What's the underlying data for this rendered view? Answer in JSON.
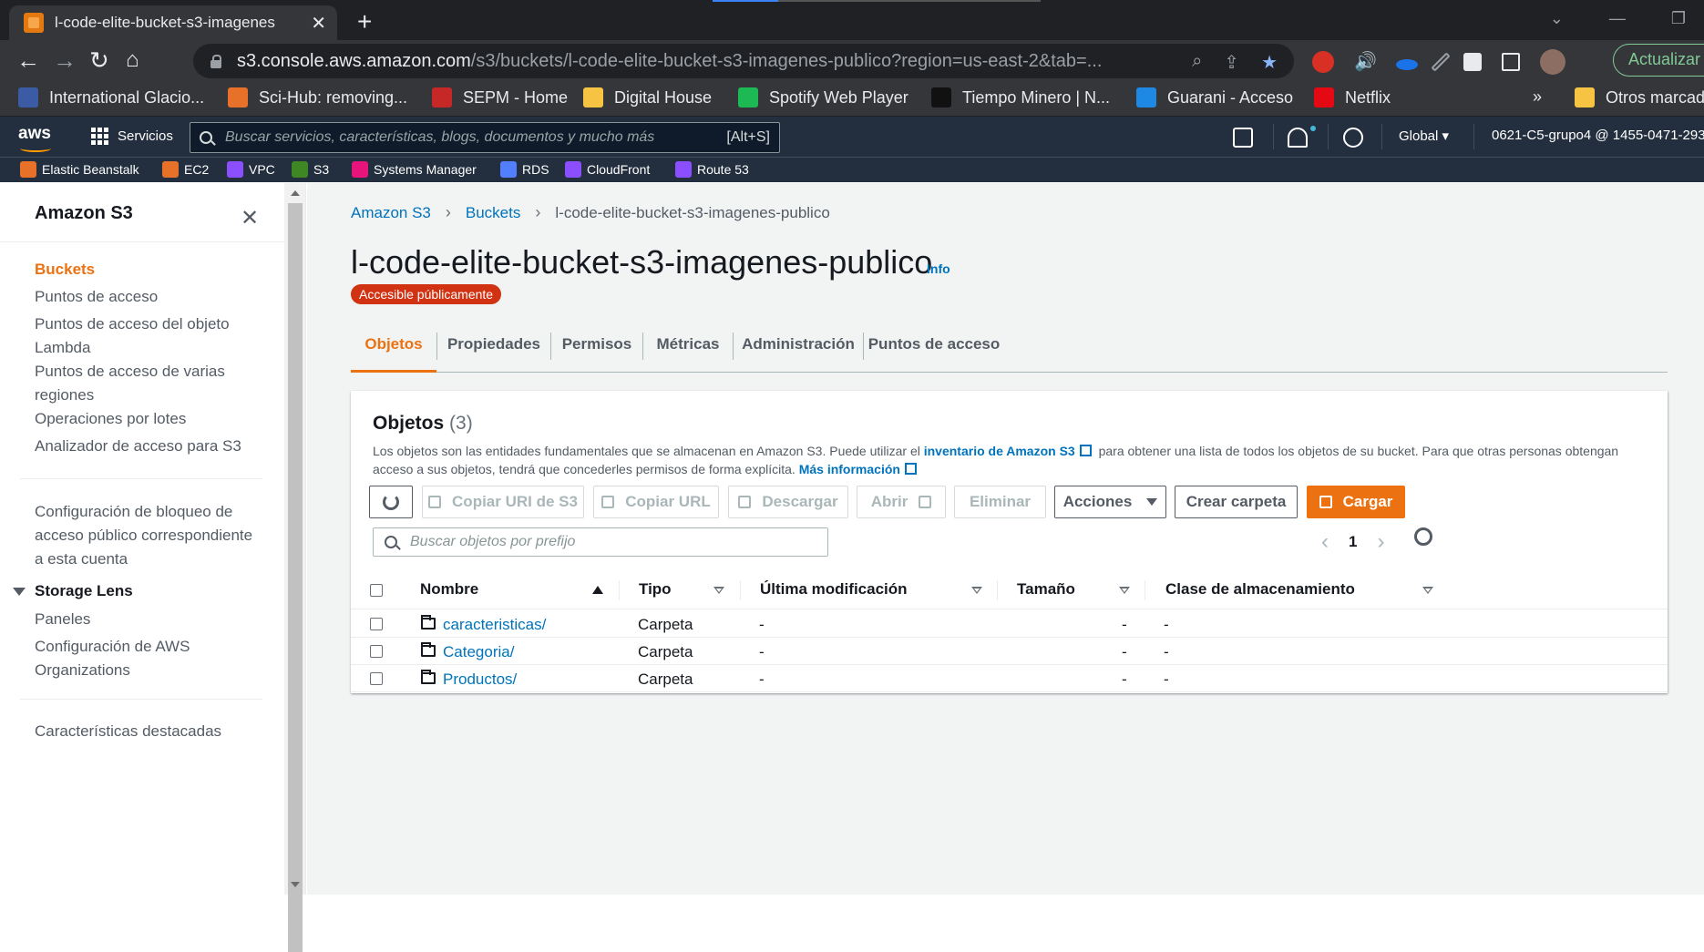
{
  "browser": {
    "tab_title": "l-code-elite-bucket-s3-imagenes",
    "tab_close": "✕",
    "new_tab": "+",
    "url_host": "s3.console.aws.amazon.com",
    "url_path": "/s3/buckets/l-code-elite-bucket-s3-imagenes-publico?region=us-east-2&tab=...",
    "update_label": "Actualizar",
    "bookmarks": [
      {
        "label": "International Glacio...",
        "color": "#3b5ba5"
      },
      {
        "label": "Sci-Hub: removing...",
        "color": "#e8712a"
      },
      {
        "label": "SEPM - Home",
        "color": "#c62828"
      },
      {
        "label": "Digital House",
        "color": "#f6c343"
      },
      {
        "label": "Spotify Web Player",
        "color": "#1db954"
      },
      {
        "label": "Tiempo Minero | N...",
        "color": "#111111"
      },
      {
        "label": "Guarani - Acceso",
        "color": "#1e88e5"
      },
      {
        "label": "Netflix",
        "color": "#e50914"
      }
    ],
    "more_bookmarks": "»",
    "other_bookmarks": "Otros marcad"
  },
  "aws": {
    "logo": "aws",
    "services_label": "Servicios",
    "search_placeholder": "Buscar servicios, características, blogs, documentos y mucho más",
    "search_shortcut": "[Alt+S]",
    "region_label": "Global",
    "account_label": "0621-C5-grupo4 @ 1455-0471-293",
    "favorites": [
      {
        "label": "Elastic Beanstalk",
        "color": "#e8712a"
      },
      {
        "label": "EC2",
        "color": "#e8712a"
      },
      {
        "label": "VPC",
        "color": "#8c4fff"
      },
      {
        "label": "S3",
        "color": "#3f8624"
      },
      {
        "label": "Systems Manager",
        "color": "#e7157b"
      },
      {
        "label": "RDS",
        "color": "#527fff"
      },
      {
        "label": "CloudFront",
        "color": "#8c4fff"
      },
      {
        "label": "Route 53",
        "color": "#8c4fff"
      }
    ]
  },
  "sidebar": {
    "title": "Amazon S3",
    "close": "✕",
    "items": [
      {
        "label": "Buckets"
      },
      {
        "label": "Puntos de acceso"
      },
      {
        "label": "Puntos de acceso del objeto Lambda"
      },
      {
        "label": "Puntos de acceso de varias regiones"
      },
      {
        "label": "Operaciones por lotes"
      },
      {
        "label": "Analizador de acceso para S3"
      }
    ],
    "block_config": "Configuración de bloqueo de acceso público correspondiente a esta cuenta",
    "storage_lens": "Storage Lens",
    "storage_items": [
      {
        "label": "Paneles"
      },
      {
        "label": "Configuración de AWS Organizations"
      }
    ],
    "featured": "Características destacadas"
  },
  "main": {
    "breadcrumb": [
      "Amazon S3",
      "Buckets",
      "l-code-elite-bucket-s3-imagenes-publico"
    ],
    "title": "l-code-elite-bucket-s3-imagenes-publico",
    "info": "Info",
    "public_badge": "Accesible públicamente",
    "tabs": [
      "Objetos",
      "Propiedades",
      "Permisos",
      "Métricas",
      "Administración",
      "Puntos de acceso"
    ],
    "objects": {
      "title": "Objetos",
      "count": "(3)",
      "desc_part1": "Los objetos son las entidades fundamentales que se almacenan en Amazon S3. Puede utilizar el ",
      "desc_link1": "inventario de Amazon S3",
      "desc_part2": " para obtener una lista de todos los objetos de su bucket. Para que otras personas obtengan acceso a sus objetos, tendrá que concederles permisos de forma explícita. ",
      "desc_link2": "Más información",
      "buttons": {
        "copy_uri": "Copiar URI de S3",
        "copy_url": "Copiar URL",
        "download": "Descargar",
        "open": "Abrir",
        "delete": "Eliminar",
        "actions": "Acciones",
        "create_folder": "Crear carpeta",
        "upload": "Cargar"
      },
      "search_placeholder": "Buscar objetos por prefijo",
      "page": "1",
      "columns": [
        "Nombre",
        "Tipo",
        "Última modificación",
        "Tamaño",
        "Clase de almacenamiento"
      ],
      "rows": [
        {
          "name": "caracteristicas/",
          "type": "Carpeta",
          "modified": "-",
          "size": "-",
          "storage": "-"
        },
        {
          "name": "Categoria/",
          "type": "Carpeta",
          "modified": "-",
          "size": "-",
          "storage": "-"
        },
        {
          "name": "Productos/",
          "type": "Carpeta",
          "modified": "-",
          "size": "-",
          "storage": "-"
        }
      ]
    }
  }
}
